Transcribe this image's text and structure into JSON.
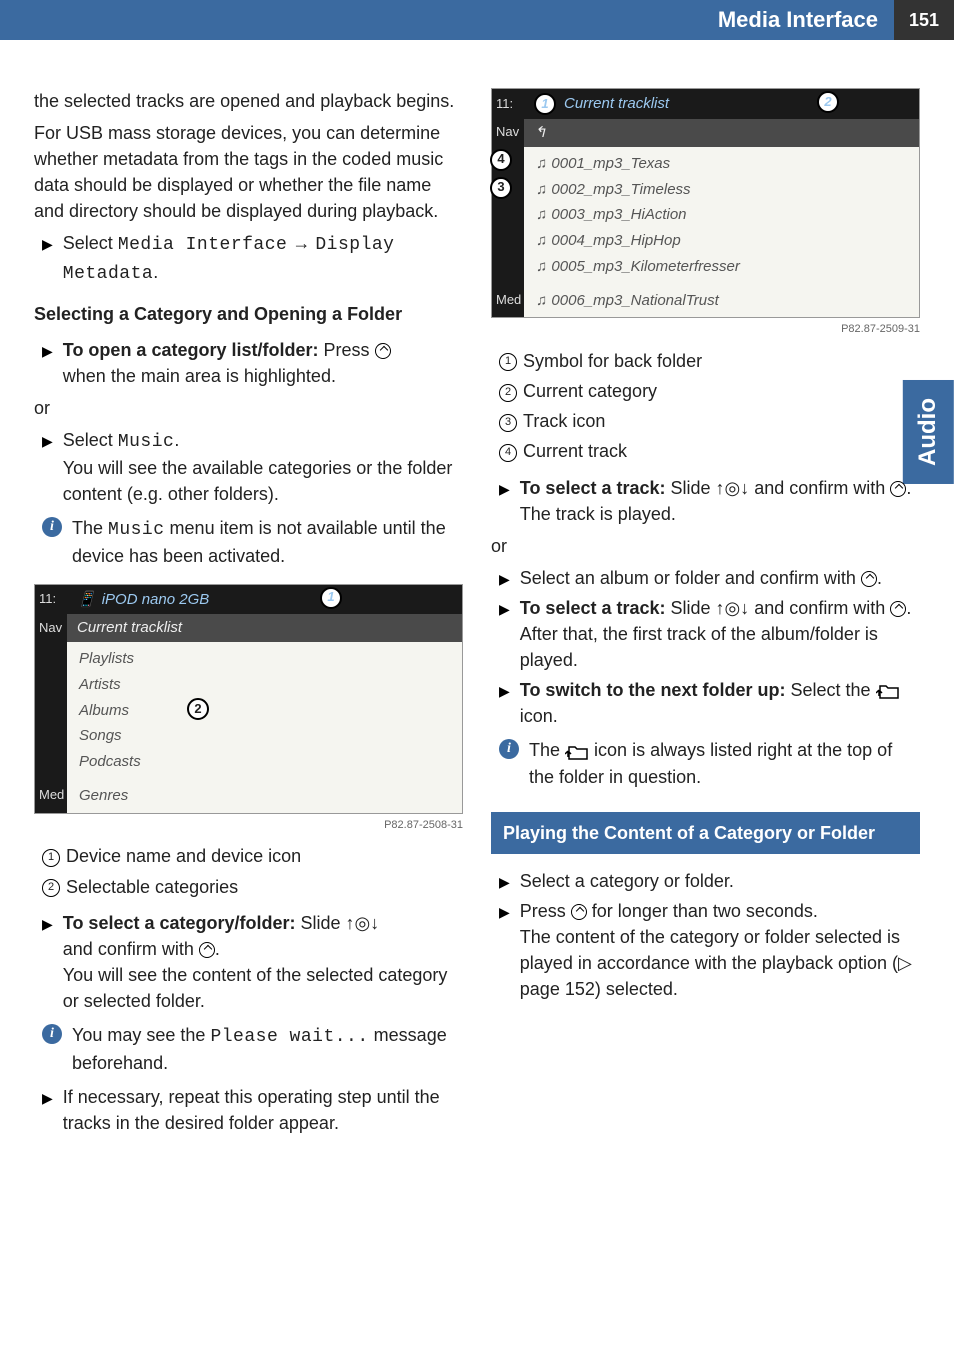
{
  "header": {
    "title": "Media Interface",
    "page": "151"
  },
  "side_tab": "Audio",
  "left": {
    "intro1": "the selected tracks are opened and playback begins.",
    "intro2": "For USB mass storage devices, you can determine whether metadata from the tags in the coded music data should be displayed or whether the file name and directory should be displayed during playback.",
    "select_display": "Select ",
    "media_interface": "Media Interface",
    "arrow": " → ",
    "display_metadata": "Display Metadata",
    "period": ".",
    "heading1": "Selecting a Category and Opening a Folder",
    "open_cat_label": "To open a category list/folder:",
    "open_cat_rest": " Press ",
    "open_cat_after": "when the main area is highlighted.",
    "or": "or",
    "select_music": "Select ",
    "music": "Music",
    "select_music_after": "You will see the available categories or the folder content (e.g. other folders).",
    "info1_pre": "The ",
    "info1_mono": "Music",
    "info1_post": " menu item is not available until the device has been activated.",
    "ss1": {
      "time": "11:",
      "icon_text": "iPOD nano 2GB",
      "nav": "Nav",
      "subhead": "Current tracklist",
      "items": [
        "Playlists",
        "Artists",
        "Albums",
        "Songs",
        "Podcasts",
        "Genres"
      ],
      "med": "Med",
      "caption": "P82.87-2508-31"
    },
    "legend1": {
      "n1": "Device name and device icon",
      "n2": "Selectable categories"
    },
    "select_cat_label": "To select a category/folder:",
    "select_cat_rest": " Slide ",
    "select_cat_after1": "and confirm with ",
    "select_cat_after2": "You will see the content of the selected category or selected folder.",
    "info2_pre": "You may see the ",
    "info2_mono": "Please wait...",
    "info2_post": " message beforehand.",
    "repeat_step": "If necessary, repeat this operating step until the tracks in the desired folder appear."
  },
  "right": {
    "ss2": {
      "time": "11:",
      "header_text": "Current tracklist",
      "nav": "Nav",
      "items": [
        "0001_mp3_Texas",
        "0002_mp3_Timeless",
        "0003_mp3_HiAction",
        "0004_mp3_HipHop",
        "0005_mp3_Kilometerfresser",
        "0006_mp3_NationalTrust"
      ],
      "med": "Med",
      "caption": "P82.87-2509-31"
    },
    "legend2": {
      "n1": "Symbol for back folder",
      "n2": "Current category",
      "n3": "Track icon",
      "n4": "Current track"
    },
    "select_track_label": "To select a track:",
    "select_track_rest": " Slide ",
    "and_confirm": " and confirm with ",
    "track_played": "The track is played.",
    "or": "or",
    "select_album": "Select an album or folder and confirm with ",
    "after_that": "After that, the first track of the album/folder is played.",
    "switch_folder_label": "To switch to the next folder up:",
    "switch_folder_rest": " Select the ",
    "switch_folder_end": " icon.",
    "info3_pre": "The ",
    "info3_post": " icon is always listed right at the top of the folder in question.",
    "subheading": "Playing the Content of a Category or Folder",
    "play_step1": "Select a category or folder.",
    "play_step2_pre": "Press ",
    "play_step2_post": " for longer than two seconds.",
    "play_step2_after": "The content of the category or folder selected is played in accordance with the playback option (▷ page 152) selected."
  }
}
